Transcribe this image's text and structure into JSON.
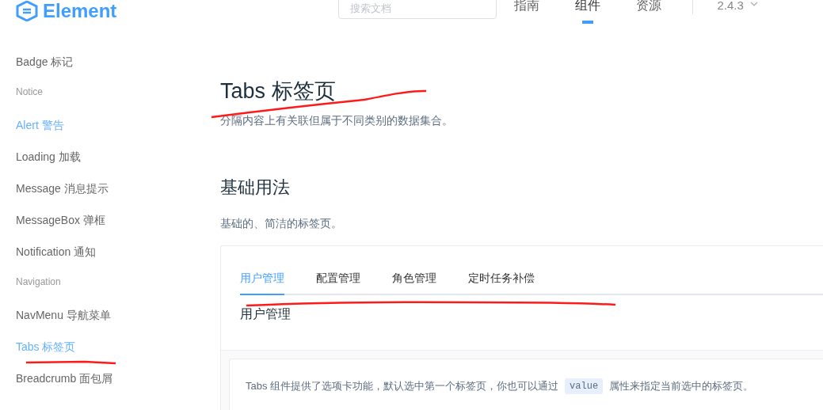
{
  "header": {
    "logo": "Element",
    "search": {
      "placeholder": "搜索文档"
    },
    "nav": [
      {
        "label": "指南",
        "selected": false
      },
      {
        "label": "组件",
        "selected": true
      },
      {
        "label": "资源",
        "selected": false
      }
    ],
    "version": "2.4.3"
  },
  "sidebar": [
    {
      "kind": "item",
      "label": "Badge 标记",
      "selected": false
    },
    {
      "kind": "group",
      "label": "Notice"
    },
    {
      "kind": "item",
      "label": "Alert 警告",
      "selected": true
    },
    {
      "kind": "item",
      "label": "Loading 加载",
      "selected": false
    },
    {
      "kind": "item",
      "label": "Message 消息提示",
      "selected": false
    },
    {
      "kind": "item",
      "label": "MessageBox 弹框",
      "selected": false
    },
    {
      "kind": "item",
      "label": "Notification 通知",
      "selected": false
    },
    {
      "kind": "group",
      "label": "Navigation"
    },
    {
      "kind": "item",
      "label": "NavMenu 导航菜单",
      "selected": false
    },
    {
      "kind": "item",
      "label": "Tabs 标签页",
      "selected": true
    },
    {
      "kind": "item",
      "label": "Breadcrumb 面包屑",
      "selected": false
    }
  ],
  "page": {
    "title": "Tabs 标签页",
    "subtitle": "分隔内容上有关联但属于不同类别的数据集合。",
    "section": "基础用法",
    "section_desc": "基础的、简洁的标签页。",
    "demo": {
      "tabs": [
        {
          "label": "用户管理",
          "selected": true
        },
        {
          "label": "配置管理",
          "selected": false
        },
        {
          "label": "角色管理",
          "selected": false
        },
        {
          "label": "定时任务补偿",
          "selected": false
        }
      ],
      "content": "用户管理",
      "description": [
        "Tabs 组件提供了选项卡功能，默认选中第一个标签页，你也可以通过",
        "value",
        "属性来指定当前选中的标签页。"
      ]
    }
  }
}
